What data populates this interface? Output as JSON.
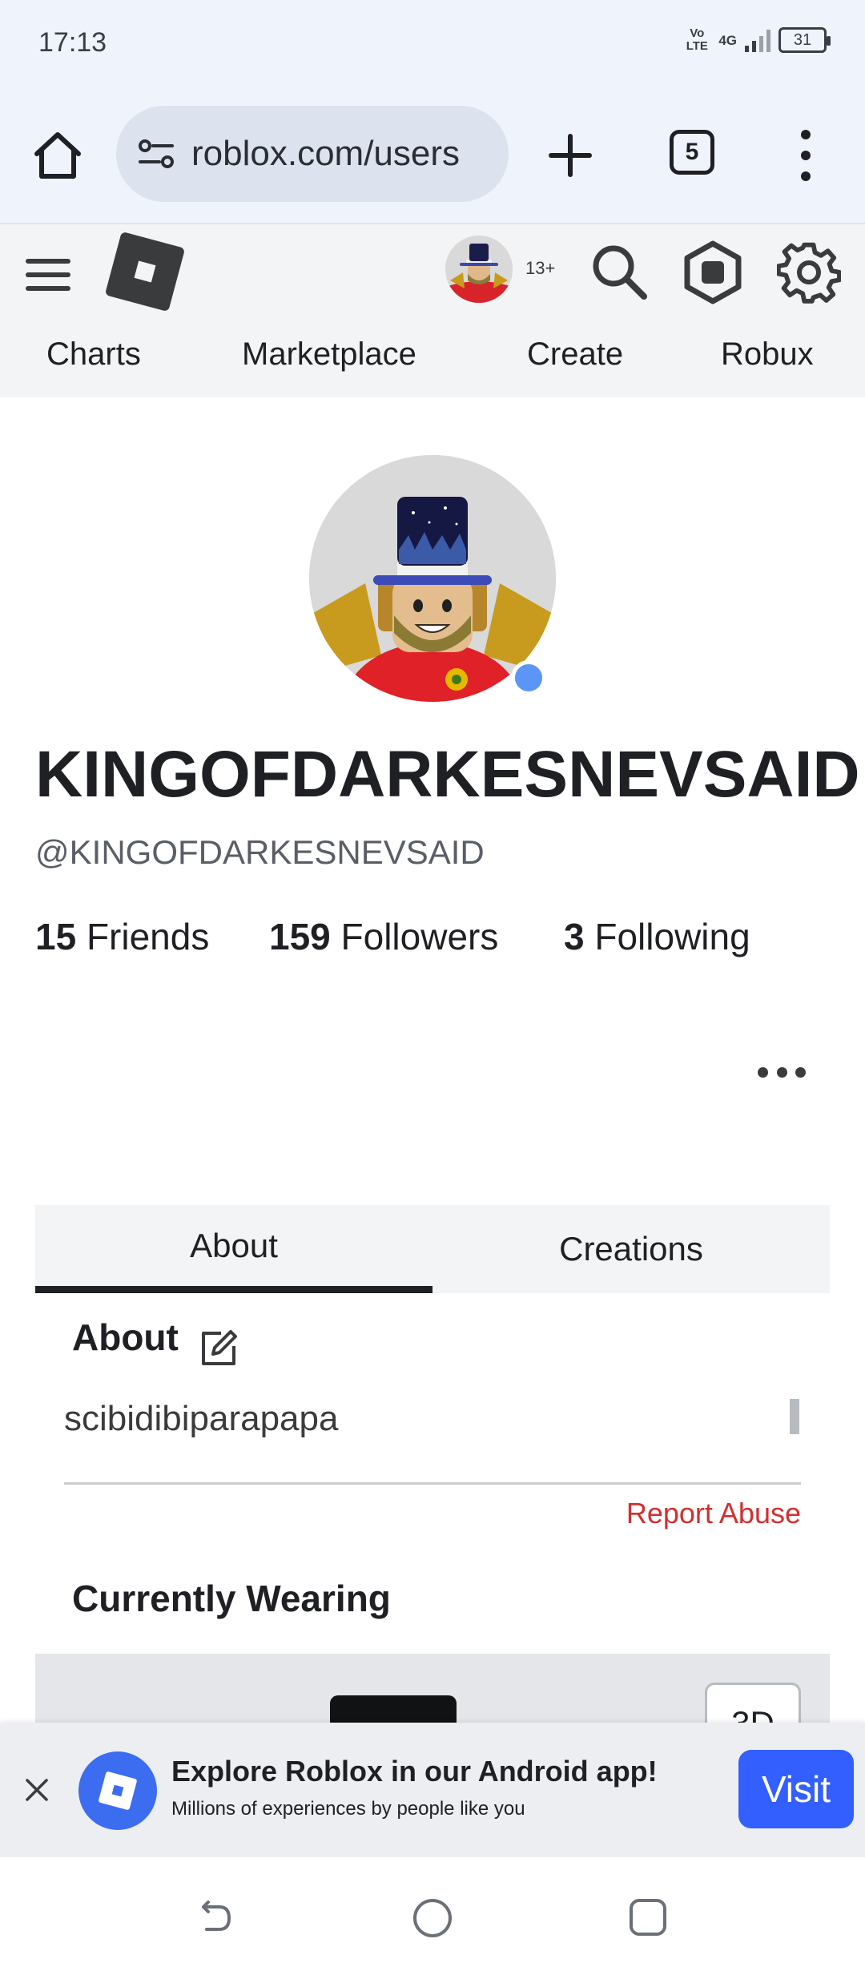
{
  "status_bar": {
    "time": "17:13",
    "network_top": "Vo LTE",
    "network_type": "4G",
    "battery": "31"
  },
  "browser": {
    "url": "roblox.com/users",
    "tab_count": "5"
  },
  "header": {
    "age_badge": "13+",
    "nav": [
      "Charts",
      "Marketplace",
      "Create",
      "Robux"
    ]
  },
  "profile": {
    "display_name": "KINGOFDARKESNEVSAID",
    "username": "@KINGOFDARKESNEVSAID",
    "stats": {
      "friends_count": "15",
      "friends_label": "Friends",
      "followers_count": "159",
      "followers_label": "Followers",
      "following_count": "3",
      "following_label": "Following"
    },
    "online_color": "#5b95f6"
  },
  "tabs": {
    "about": "About",
    "creations": "Creations"
  },
  "about": {
    "title": "About",
    "text": "scibidibiparapapa",
    "report": "Report Abuse"
  },
  "wearing": {
    "title": "Currently Wearing",
    "btn_3d": "3D"
  },
  "app_banner": {
    "title": "Explore Roblox in our Android app!",
    "subtitle": "Millions of experiences by people like you",
    "visit": "Visit"
  },
  "colors": {
    "accent_blue": "#335fff",
    "report_red": "#d32f2f"
  }
}
